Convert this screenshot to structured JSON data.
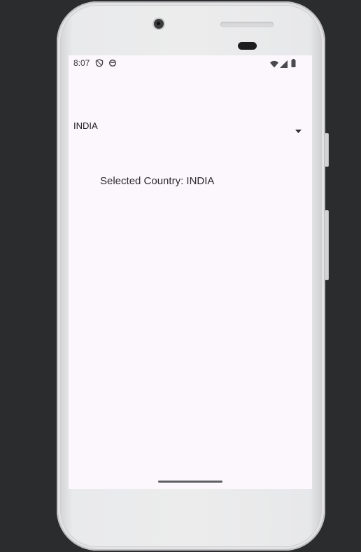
{
  "status_bar": {
    "time": "8:07",
    "left_icons": [
      "shield-icon",
      "sync-icon"
    ],
    "right_icons": [
      "wifi-icon",
      "signal-icon",
      "battery-icon"
    ]
  },
  "spinner": {
    "selected_value": "INDIA",
    "arrow_icon": "dropdown-arrow-icon"
  },
  "selected_label": "Selected Country: INDIA",
  "colors": {
    "screen_background": "#fcf7fd",
    "text": "#1c1b1f",
    "backdrop": "#2b2c2e"
  }
}
